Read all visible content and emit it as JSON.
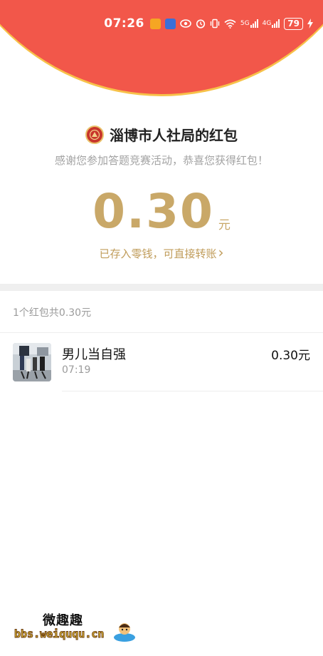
{
  "status_bar": {
    "time": "07:26",
    "battery": "79",
    "signal1": "5G",
    "signal2": "4G"
  },
  "header": {
    "back_icon": "chevron-left-icon",
    "more_icon": "more-dots-icon"
  },
  "red_packet": {
    "sender_name": "淄博市人社局的红包",
    "thanks_text": "感谢您参加答题竞赛活动，恭喜您获得红包！",
    "amount": "0.30",
    "unit": "元",
    "saved_text": "已存入零钱，可直接转账",
    "saved_chevron": "›"
  },
  "list": {
    "summary": "1个红包共0.30元",
    "items": [
      {
        "name": "男儿当自强",
        "time": "07:19",
        "amount": "0.30元"
      }
    ]
  },
  "watermark": {
    "title": "微趣趣",
    "url": "bbs.weiququ.cn"
  },
  "colors": {
    "header_red": "#f2574a",
    "gold": "#c9a868"
  }
}
